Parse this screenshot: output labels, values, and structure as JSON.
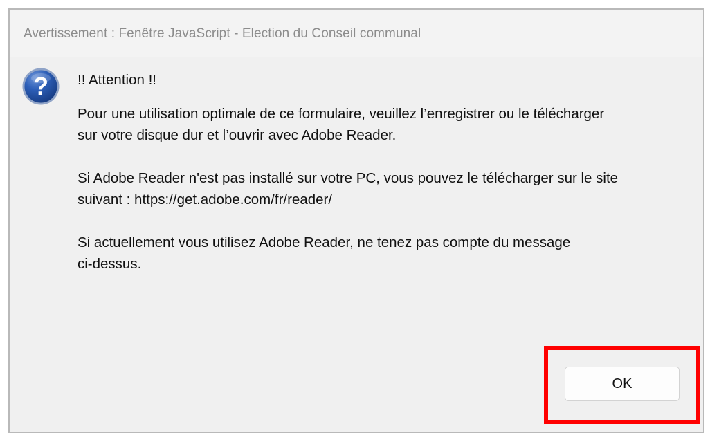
{
  "window": {
    "title": "Avertissement : Fenêtre JavaScript - Election du Conseil communal"
  },
  "icon": {
    "name": "question-icon",
    "glyph": "?",
    "color": "#1f4fa8"
  },
  "message": {
    "heading": "!! Attention !!",
    "paragraph1": "Pour une utilisation optimale de ce formulaire, veuillez l’enregistrer ou le télécharger\nsur votre disque dur et l’ouvrir avec Adobe Reader.",
    "paragraph2": "Si Adobe Reader n'est pas installé sur votre PC, vous pouvez le télécharger sur le site\nsuivant :  https://get.adobe.com/fr/reader/",
    "paragraph3": "Si actuellement vous utilisez Adobe Reader, ne tenez pas compte du message\nci-dessus."
  },
  "buttons": {
    "ok_label": "OK"
  },
  "colors": {
    "highlight": "#ff0000",
    "dialog_background": "#f0f0f0"
  }
}
